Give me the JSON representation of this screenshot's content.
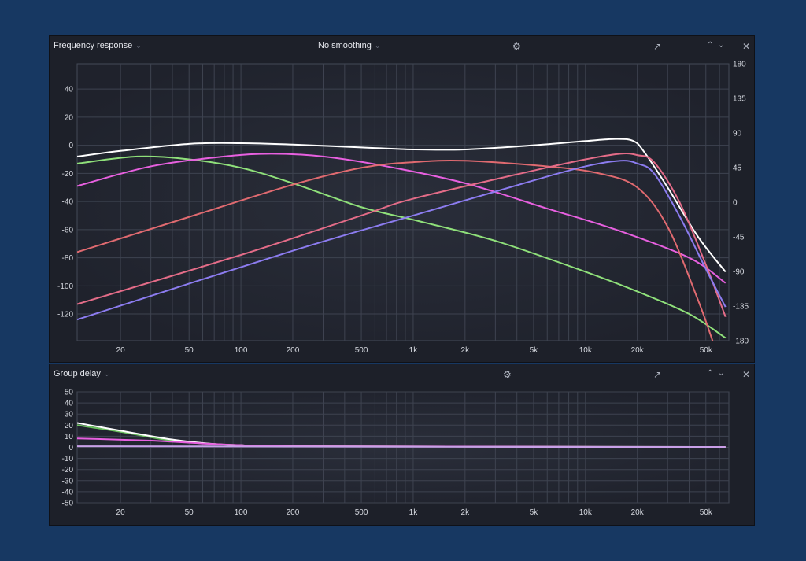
{
  "panels": {
    "fr": {
      "title": "Frequency response",
      "smoothing": "No smoothing"
    },
    "gd": {
      "title": "Group delay"
    }
  },
  "icons": [
    "settings-gear-icon",
    "export-icon",
    "chevron-up-icon",
    "chevron-down-icon",
    "close-icon"
  ],
  "chart_data": [
    {
      "type": "line",
      "title": "Frequency response",
      "xscale": "log",
      "xlim": [
        11.2,
        68000
      ],
      "ylim": [
        -139,
        58
      ],
      "y2lim": [
        -180,
        180
      ],
      "x_ticks": [
        "20",
        "50",
        "100",
        "200",
        "500",
        "1k",
        "2k",
        "5k",
        "10k",
        "20k",
        "50k"
      ],
      "y_ticks": [
        "40",
        "20",
        "0",
        "-20",
        "-40",
        "-60",
        "-80",
        "-100",
        "-120"
      ],
      "y2_ticks": [
        "180",
        "135",
        "90",
        "45",
        "0",
        "-45",
        "-90",
        "-135",
        "-180"
      ],
      "series": [
        {
          "name": "white",
          "color": "#ffffff",
          "points": [
            [
              11.2,
              -8
            ],
            [
              20,
              -4
            ],
            [
              50,
              1
            ],
            [
              100,
              1.5
            ],
            [
              200,
              0.5
            ],
            [
              500,
              -1.5
            ],
            [
              1000,
              -3
            ],
            [
              2000,
              -3
            ],
            [
              5000,
              0
            ],
            [
              10000,
              3
            ],
            [
              15000,
              4.5
            ],
            [
              19000,
              3
            ],
            [
              22000,
              -5
            ],
            [
              30000,
              -30
            ],
            [
              45000,
              -65
            ],
            [
              65000,
              -90
            ]
          ]
        },
        {
          "name": "green",
          "color": "#8fe07a",
          "points": [
            [
              11.2,
              -13
            ],
            [
              25,
              -8
            ],
            [
              50,
              -10
            ],
            [
              100,
              -16
            ],
            [
              200,
              -27
            ],
            [
              500,
              -44
            ],
            [
              1000,
              -53
            ],
            [
              3000,
              -68
            ],
            [
              10000,
              -90
            ],
            [
              20000,
              -104
            ],
            [
              40000,
              -120
            ],
            [
              65000,
              -137
            ]
          ]
        },
        {
          "name": "magenta",
          "color": "#e860e0",
          "points": [
            [
              11.2,
              -29
            ],
            [
              30,
              -15
            ],
            [
              80,
              -8
            ],
            [
              150,
              -6
            ],
            [
              300,
              -8
            ],
            [
              700,
              -15
            ],
            [
              2000,
              -27
            ],
            [
              6000,
              -45
            ],
            [
              15000,
              -60
            ],
            [
              40000,
              -80
            ],
            [
              65000,
              -98
            ]
          ]
        },
        {
          "name": "red-1",
          "color": "#e06a70",
          "points": [
            [
              11.2,
              -76
            ],
            [
              50,
              -51
            ],
            [
              200,
              -28
            ],
            [
              500,
              -16
            ],
            [
              1000,
              -12
            ],
            [
              2000,
              -11
            ],
            [
              6000,
              -15
            ],
            [
              12000,
              -20
            ],
            [
              20000,
              -30
            ],
            [
              30000,
              -58
            ],
            [
              45000,
              -110
            ],
            [
              55000,
              -140
            ]
          ]
        },
        {
          "name": "red-2",
          "color": "#e46c88",
          "points": [
            [
              11.2,
              -113
            ],
            [
              100,
              -78
            ],
            [
              500,
              -50
            ],
            [
              1000,
              -38
            ],
            [
              5000,
              -18
            ],
            [
              10000,
              -10
            ],
            [
              16000,
              -6
            ],
            [
              20000,
              -7
            ],
            [
              25000,
              -12
            ],
            [
              35000,
              -40
            ],
            [
              50000,
              -85
            ],
            [
              65000,
              -122
            ]
          ]
        },
        {
          "name": "blue",
          "color": "#8c7cf0",
          "points": [
            [
              11.2,
              -124
            ],
            [
              200,
              -75
            ],
            [
              1000,
              -50
            ],
            [
              5000,
              -25
            ],
            [
              10000,
              -15
            ],
            [
              16000,
              -11
            ],
            [
              20000,
              -13
            ],
            [
              25000,
              -20
            ],
            [
              35000,
              -50
            ],
            [
              50000,
              -88
            ],
            [
              65000,
              -115
            ]
          ]
        }
      ]
    },
    {
      "type": "line",
      "title": "Group delay",
      "xscale": "log",
      "xlim": [
        11.2,
        68000
      ],
      "ylim": [
        -50,
        50
      ],
      "x_ticks": [
        "20",
        "50",
        "100",
        "200",
        "500",
        "1k",
        "2k",
        "5k",
        "10k",
        "20k",
        "50k"
      ],
      "y_ticks": [
        "50",
        "40",
        "30",
        "20",
        "10",
        "0",
        "-10",
        "-20",
        "-30",
        "-40",
        "-50"
      ],
      "series": [
        {
          "name": "green",
          "color": "#6cc060",
          "points": [
            [
              11.2,
              20
            ],
            [
              20,
              14
            ],
            [
              40,
              6
            ],
            [
              70,
              3
            ],
            [
              100,
              2
            ],
            [
              200,
              1
            ],
            [
              65000,
              0.3
            ]
          ]
        },
        {
          "name": "white",
          "color": "#ffffff",
          "points": [
            [
              11.2,
              22
            ],
            [
              20,
              15
            ],
            [
              40,
              7
            ],
            [
              70,
              3
            ],
            [
              100,
              2
            ],
            [
              200,
              1
            ],
            [
              65000,
              0.3
            ]
          ]
        },
        {
          "name": "magenta",
          "color": "#e860e0",
          "points": [
            [
              11.2,
              8
            ],
            [
              30,
              6
            ],
            [
              60,
              3.5
            ],
            [
              100,
              2
            ],
            [
              200,
              1
            ],
            [
              65000,
              0.3
            ]
          ]
        },
        {
          "name": "lavender",
          "color": "#c8a0e8",
          "points": [
            [
              11.2,
              1
            ],
            [
              100,
              0.8
            ],
            [
              1000,
              0.5
            ],
            [
              65000,
              0.3
            ]
          ]
        }
      ]
    }
  ]
}
